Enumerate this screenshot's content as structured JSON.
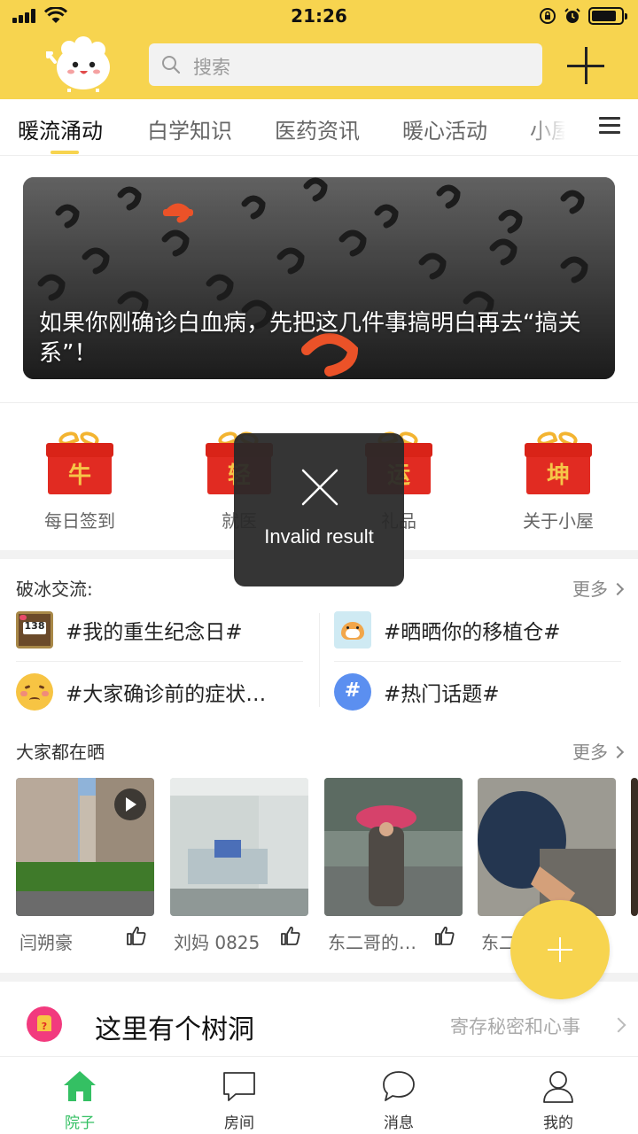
{
  "status_bar": {
    "time": "21:26"
  },
  "header": {
    "search_placeholder": "搜索"
  },
  "tabs": [
    {
      "label": "暖流涌动",
      "active": true
    },
    {
      "label": "白学知识"
    },
    {
      "label": "医药资讯"
    },
    {
      "label": "暖心活动"
    },
    {
      "label": "小屋"
    }
  ],
  "banner": {
    "title": "如果你刚确诊白血病，先把这几件事搞明白再去“搞关系”！"
  },
  "quick_actions": [
    {
      "label": "每日签到",
      "glyph": "牛"
    },
    {
      "label": "就医",
      "glyph": "轻"
    },
    {
      "label": "礼品",
      "glyph": "运"
    },
    {
      "label": "关于小屋",
      "glyph": "坤"
    }
  ],
  "icebreak": {
    "title": "破冰交流:",
    "more": "更多",
    "topics": [
      {
        "text": "#我的重生纪念日#",
        "icon": "calendar-138-icon",
        "badge": "138"
      },
      {
        "text": "#晒晒你的移植仓#",
        "icon": "hamster-icon"
      },
      {
        "text": "#大家确诊前的症状…",
        "icon": "sad-face-icon"
      },
      {
        "text": "#热门话题#",
        "icon": "hashtag-bubble-icon",
        "badge": "#"
      }
    ]
  },
  "showcase": {
    "title": "大家都在晒",
    "more": "更多",
    "items": [
      {
        "author": "闫朔豪"
      },
      {
        "author": "刘妈 0825"
      },
      {
        "author": "东二哥的…"
      },
      {
        "author": "东二"
      }
    ]
  },
  "tree_hole": {
    "title": "这里有个树洞",
    "subtitle": "寄存秘密和心事"
  },
  "tabbar": [
    {
      "label": "院子",
      "active": true
    },
    {
      "label": "房间"
    },
    {
      "label": "消息"
    },
    {
      "label": "我的"
    }
  ],
  "toast": {
    "message": "Invalid result"
  },
  "colors": {
    "accent_yellow": "#f7d44f",
    "active_green": "#34c063"
  }
}
